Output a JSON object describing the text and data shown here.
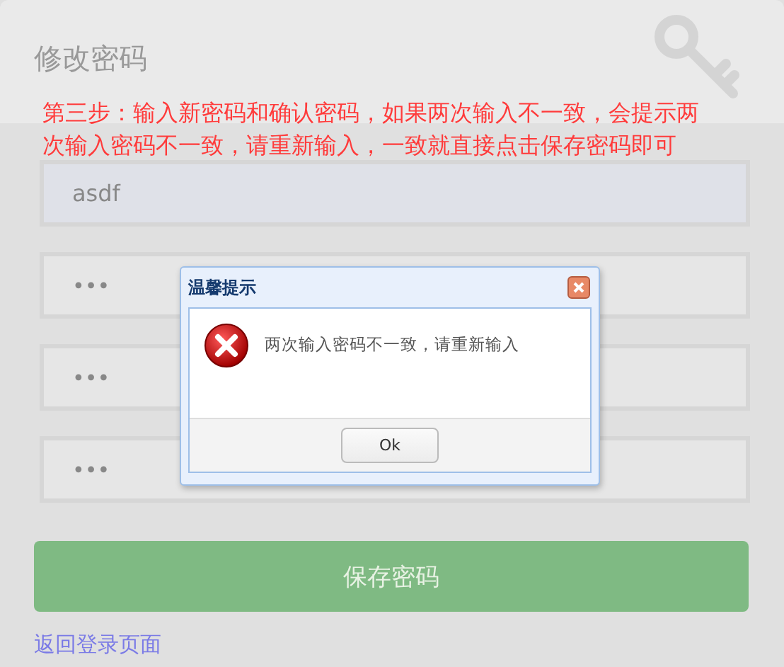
{
  "page": {
    "title": "修改密码",
    "instruction": "第三步：输入新密码和确认密码，如果两次输入不一致，会提示两次输入密码不一致，请重新输入，一致就直接点击保存密码即可"
  },
  "fields": [
    {
      "value": "asdf",
      "focused": true
    },
    {
      "value": "•••",
      "focused": false
    },
    {
      "value": "•••",
      "focused": false
    },
    {
      "value": "•••",
      "focused": false
    }
  ],
  "save_button": "保存密码",
  "back_link": "返回登录页面",
  "dialog": {
    "title": "温馨提示",
    "message": "两次输入密码不一致，请重新输入",
    "ok_button": "Ok"
  }
}
